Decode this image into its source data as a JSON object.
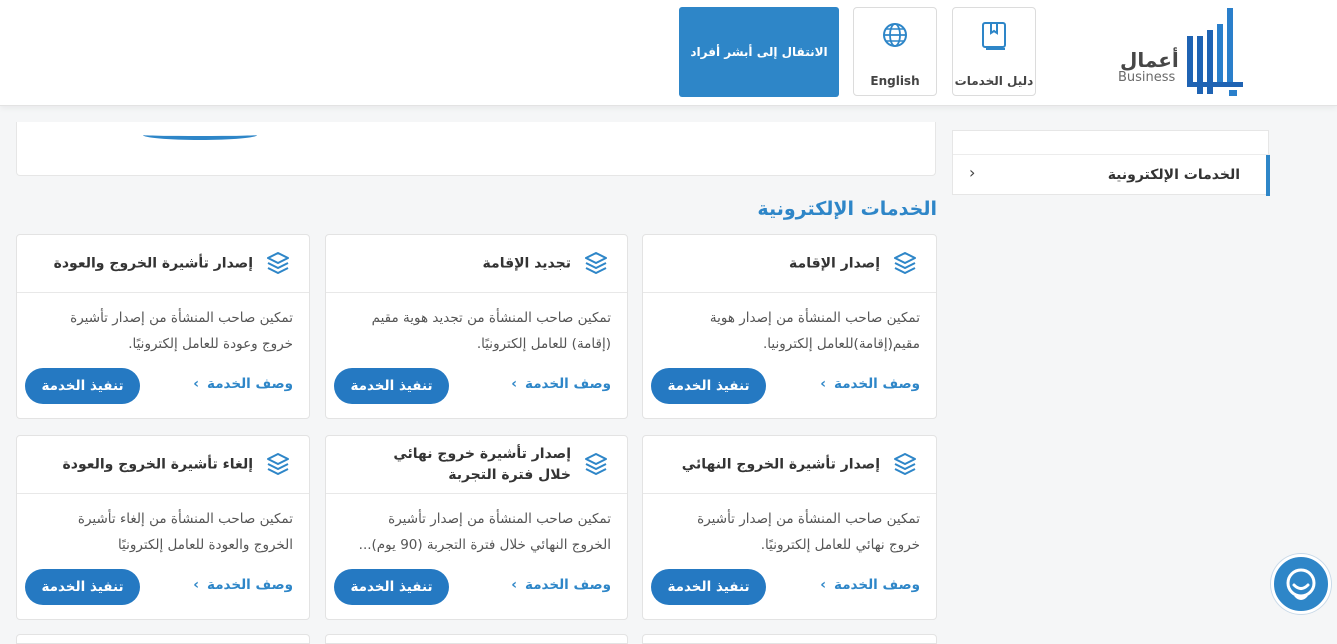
{
  "header": {
    "logo": {
      "arabic": "أعمال",
      "english": "Business"
    },
    "guide_label": "دليل الخدمات",
    "lang_label": "English",
    "absher_label": "الانتقال إلى أبشر أفراد"
  },
  "sidebar": {
    "active_item": "الخدمات الإلكترونية"
  },
  "section_title": "الخدمات الإلكترونية",
  "cards": [
    {
      "title": "إصدار الإقامة",
      "desc1": "تمكين صاحب المنشأة من إصدار هوية",
      "desc2": "مقيم(إقامة)للعامل إلكترونيا.",
      "link": "وصف الخدمة",
      "action": "تنفيذ الخدمة"
    },
    {
      "title": "تجديد الإقامة",
      "desc1": "تمكين صاحب المنشأة من تجديد هوية مقيم",
      "desc2": "(إقامة) للعامل إلكترونيًا.",
      "link": "وصف الخدمة",
      "action": "تنفيذ الخدمة"
    },
    {
      "title": "إصدار تأشيرة الخروج والعودة",
      "desc1": "تمكين صاحب المنشأة من إصدار تأشيرة",
      "desc2": "خروج وعودة للعامل إلكترونيًا.",
      "link": "وصف الخدمة",
      "action": "تنفيذ الخدمة"
    },
    {
      "title": "إصدار تأشيرة الخروج النهائي",
      "desc1": "تمكين صاحب المنشأة من إصدار تأشيرة",
      "desc2": "خروج نهائي للعامل إلكترونيًا.",
      "link": "وصف الخدمة",
      "action": "تنفيذ الخدمة"
    },
    {
      "title": "إصدار تأشيرة خروج نهائي خلال فترة التجربة",
      "desc1": "تمكين صاحب المنشأة من إصدار تأشيرة",
      "desc2": "الخروج النهائي خلال فترة التجربة (90 يوم)...",
      "link": "وصف الخدمة",
      "action": "تنفيذ الخدمة"
    },
    {
      "title": "إلغاء تأشيرة الخروج والعودة",
      "desc1": "تمكين صاحب المنشأة من إلغاء تأشيرة",
      "desc2": "الخروج والعودة للعامل إلكترونيًا",
      "link": "وصف الخدمة",
      "action": "تنفيذ الخدمة"
    }
  ],
  "colors": {
    "accent": "#2e86c8",
    "button": "#2579c2",
    "title": "#333333"
  },
  "icons": [
    "book-icon",
    "globe-icon",
    "layers-icon",
    "chevron-left-icon",
    "chat-support-icon"
  ]
}
